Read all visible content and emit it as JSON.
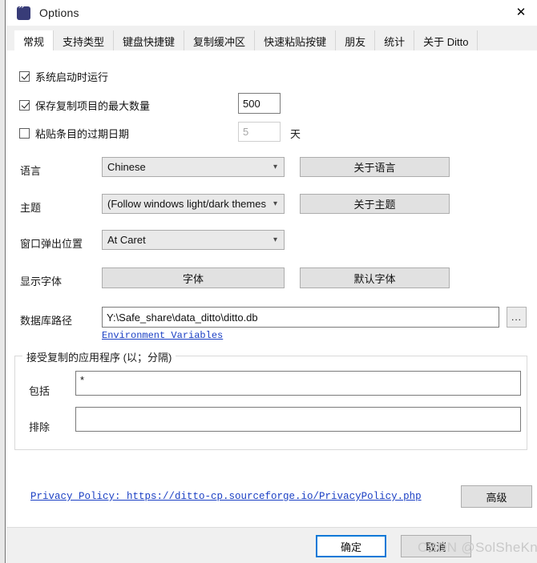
{
  "window": {
    "title": "Options",
    "icon": "ditto-quote-icon",
    "close_label": "✕"
  },
  "tabs": [
    {
      "label": "常规",
      "active": true
    },
    {
      "label": "支持类型",
      "active": false
    },
    {
      "label": "键盘快捷键",
      "active": false
    },
    {
      "label": "复制缓冲区",
      "active": false
    },
    {
      "label": "快速粘贴按键",
      "active": false
    },
    {
      "label": "朋友",
      "active": false
    },
    {
      "label": "统计",
      "active": false
    },
    {
      "label": "关于 Ditto",
      "active": false
    }
  ],
  "general": {
    "run_at_startup": {
      "label": "系统启动时运行",
      "checked": true
    },
    "max_copies": {
      "label": "保存复制项目的最大数量",
      "checked": true,
      "value": "500"
    },
    "expire_days": {
      "label": "粘贴条目的过期日期",
      "checked": false,
      "value": "5",
      "unit": "天",
      "disabled": true
    },
    "language": {
      "label": "语言",
      "value": "Chinese",
      "button": "关于语言"
    },
    "theme": {
      "label": "主题",
      "value": "(Follow windows light/dark themes)",
      "button": "关于主题"
    },
    "popup_position": {
      "label": "窗口弹出位置",
      "value": "At Caret"
    },
    "display_font": {
      "label": "显示字体",
      "font_button": "字体",
      "default_font_button": "默认字体"
    },
    "db_path": {
      "label": "数据库路径",
      "value": "Y:\\Safe_share\\data_ditto\\ditto.db",
      "browse_button": "...",
      "env_link": "Environment Variables"
    }
  },
  "apps_group": {
    "title": "接受复制的应用程序 (以；分隔)",
    "include": {
      "label": "包括",
      "value": "*"
    },
    "exclude": {
      "label": "排除",
      "value": ""
    }
  },
  "footer": {
    "privacy_link": "Privacy Policy: https://ditto-cp.sourceforge.io/PrivacyPolicy.php",
    "advanced_button": "高级",
    "ok_button": "确定",
    "cancel_button": "取消"
  },
  "watermark": "CSDN @SolSheKno",
  "colors": {
    "accent": "#0078d7",
    "link": "#1a3fc4",
    "title_icon": "#383c78",
    "tab_strip": "#f0f0f0",
    "footer": "#f0f0f0"
  }
}
